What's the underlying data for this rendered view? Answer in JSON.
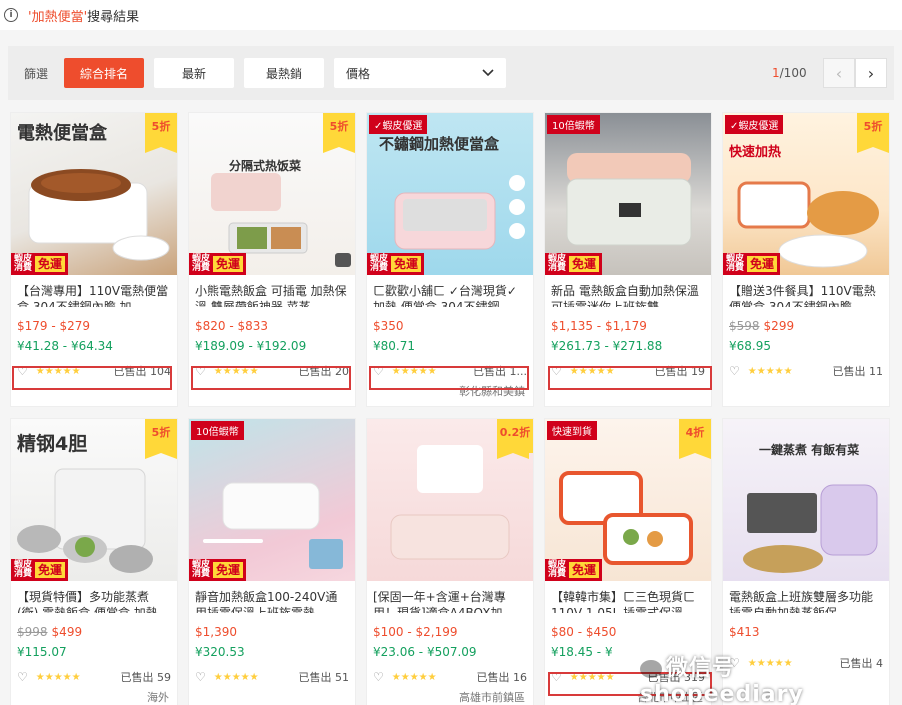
{
  "search": {
    "keyword": "'加熱便當'",
    "suffix": "搜尋結果"
  },
  "filters": {
    "label": "篩選",
    "sorts": [
      "綜合排名",
      "最新",
      "最熱銷"
    ],
    "price_label": "價格"
  },
  "pager": {
    "current": "1",
    "total": "/100",
    "prev": "‹",
    "next": "›"
  },
  "colors": {
    "accent": "#ee4d2d",
    "converted_price": "#14a05e",
    "highlight_frame": "#d83a3a"
  },
  "products": [
    {
      "image_title": "電熱便當盒",
      "discount": "5折",
      "promo": {
        "line1": "蝦皮",
        "line2": "消費",
        "tag": "免運"
      },
      "name": "【台灣專用】110V電熱便當盒 304不鏽鋼內膽 加...",
      "price": "$179 - $279",
      "converted": "¥41.28 - ¥64.34",
      "sold": "已售出 104",
      "location": ""
    },
    {
      "image_title": "分隔式热饭菜",
      "discount": "5折",
      "promo": {
        "line1": "蝦皮",
        "line2": "消費",
        "tag": "免運"
      },
      "name": "小熊電熱飯盒 可插電 加熱保溫 雙層帶飯神器 菜蒸...",
      "price": "$820 - $833",
      "converted": "¥189.09 - ¥192.09",
      "sold": "已售出 20",
      "location": ""
    },
    {
      "image_title": "不鏽鋼加熱便當盒",
      "top_tag": "✓蝦皮優選",
      "promo": {
        "line1": "蝦皮",
        "line2": "消費",
        "tag": "免運"
      },
      "name": "ㄈ歡歡小舖ㄈ ✓台灣現貨✓ 加熱 便當盒 304不鏽鋼...",
      "price": "$350",
      "converted": "¥80.71",
      "sold": "已售出 1...",
      "location": "彰化縣和美鎮"
    },
    {
      "image_title": "",
      "top_tag": "10倍蝦幣",
      "promo": {
        "line1": "蝦皮",
        "line2": "消費",
        "tag": "免運"
      },
      "name": "新品 電熱飯盒自動加熱保溫可插電迷你上班族雙...",
      "price": "$1,135 - $1,179",
      "converted": "¥261.73 - ¥271.88",
      "sold": "已售出 19",
      "location": ""
    },
    {
      "image_title": "快速加热",
      "top_tag": "✓蝦皮優選",
      "discount": "5折",
      "promo": {
        "line1": "蝦皮",
        "line2": "消費",
        "tag": "免運"
      },
      "name": "【贈送3件餐具】110V電熱便當盒 304不鏽鋼內膽...",
      "price_old": "$598",
      "price": "$299",
      "converted": "¥68.95",
      "sold": "已售出 11",
      "location": ""
    },
    {
      "image_title": "精钢4胆",
      "discount": "5折",
      "promo": {
        "line1": "蝦皮",
        "line2": "消費",
        "tag": "免運"
      },
      "name": "【現貨特價】多功能蒸煮 (衛) 電熱飯盒 便當盒 加熱...",
      "price_old": "$998",
      "price": "$499",
      "converted": "¥115.07",
      "sold": "已售出 59",
      "location": "海外"
    },
    {
      "image_title": "",
      "top_tag": "10倍蝦幣",
      "promo": {
        "line1": "蝦皮",
        "line2": "消費",
        "tag": "免運"
      },
      "name": "靜音加熱飯盒100-240V通用插電保溫上班族電熱...",
      "price": "$1,390",
      "converted": "¥320.53",
      "sold": "已售出 51",
      "location": ""
    },
    {
      "image_title": "",
      "discount": "0.2折",
      "name": "[保固一年+含運+台灣專用！現貨]適盒A4BOX加...",
      "price": "$100 - $2,199",
      "converted": "¥23.06 - ¥507.09",
      "sold": "已售出 16",
      "location": "高雄市前鎮區"
    },
    {
      "image_title": "",
      "top_tag": "快速到貨",
      "discount": "4折",
      "promo": {
        "line1": "蝦皮",
        "line2": "消費",
        "tag": "免運"
      },
      "name": "【韓韓市集】ㄈ三色現貨ㄈ 110V 1.05L 插電式保溫...",
      "price": "$80 - $450",
      "converted": "¥18.45 - ¥",
      "sold": "已售出 319",
      "location": "台北市中山區"
    },
    {
      "image_title": "一鍵蒸煮 有飯有菜",
      "name": "電熱飯盒上班族雙層多功能插電自動加熱蒸飯保...",
      "price": "$413",
      "converted": "",
      "sold": "已售出 4",
      "location": ""
    }
  ],
  "watermark": "微信号 shopeediary"
}
